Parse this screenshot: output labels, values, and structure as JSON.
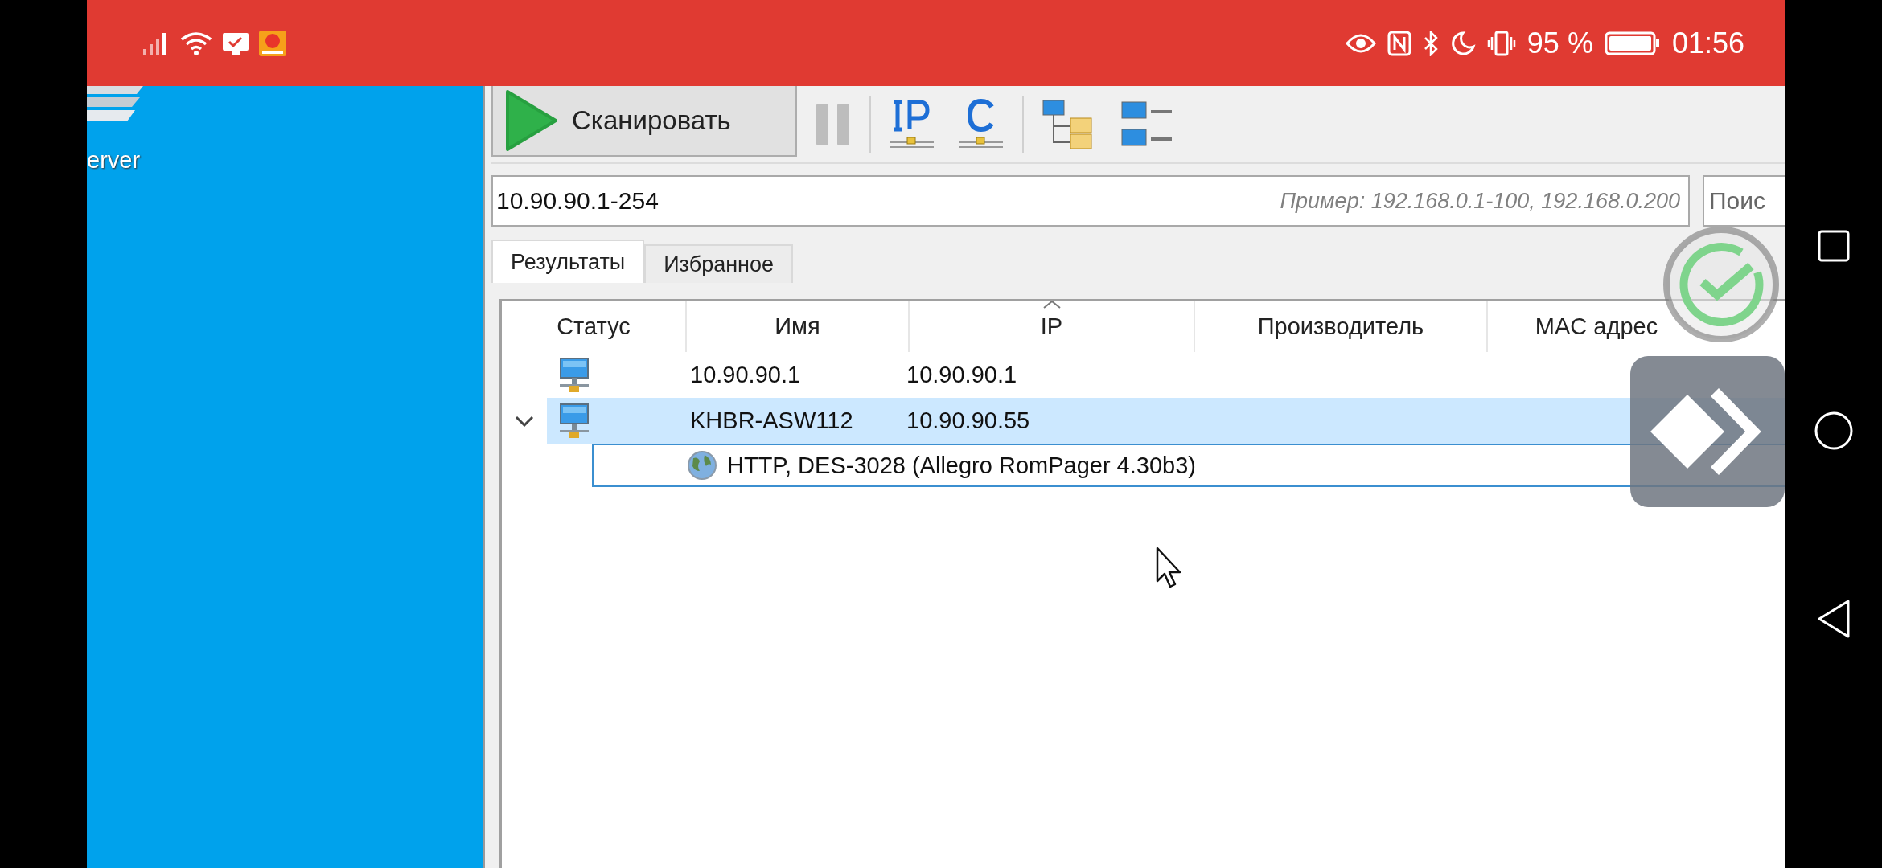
{
  "status_bar": {
    "battery": "95 %",
    "time": "01:56"
  },
  "desktop": {
    "icon_label": "erver"
  },
  "toolbar": {
    "scan_button": "Сканировать"
  },
  "range_field": {
    "value": "10.90.90.1-254",
    "hint": "Пример: 192.168.0.1-100, 192.168.0.200"
  },
  "search_field": {
    "placeholder": "Поис"
  },
  "tabs": [
    {
      "label": "Результаты",
      "selected": true
    },
    {
      "label": "Избранное",
      "selected": false
    }
  ],
  "table": {
    "columns": [
      {
        "label": "Статус",
        "sorted": false
      },
      {
        "label": "Имя",
        "sorted": false
      },
      {
        "label": "IP",
        "sorted": true
      },
      {
        "label": "Производитель",
        "sorted": false
      },
      {
        "label": "MAC адрес",
        "sorted": false
      }
    ],
    "rows": [
      {
        "name": "10.90.90.1",
        "ip": "10.90.90.1",
        "selected": false
      },
      {
        "name": "KHBR-ASW112",
        "ip": "10.90.90.55",
        "selected": true,
        "expanded": true,
        "children": [
          {
            "text": "HTTP, DES-3028 (Allegro RomPager 4.30b3)"
          }
        ]
      }
    ]
  }
}
